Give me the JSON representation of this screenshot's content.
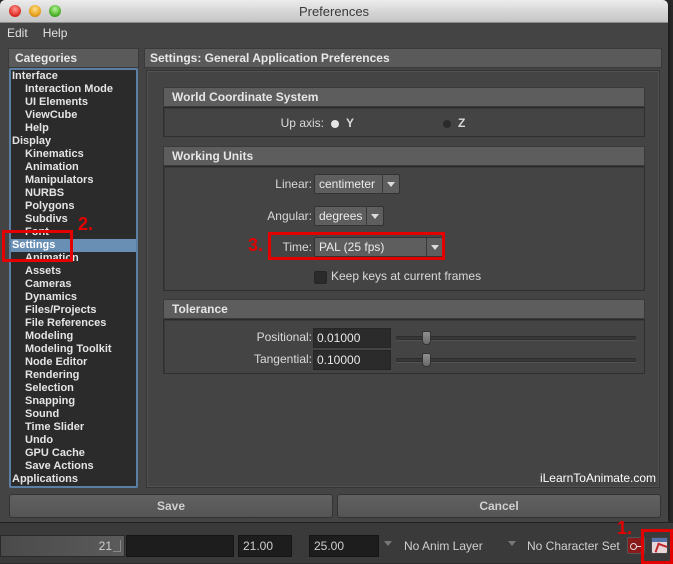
{
  "window": {
    "title": "Preferences",
    "menu": [
      "Edit",
      "Help"
    ]
  },
  "categories": {
    "header": "Categories",
    "items": [
      {
        "label": "Interface",
        "level": 0
      },
      {
        "label": "Interaction Mode",
        "level": 1
      },
      {
        "label": "UI Elements",
        "level": 1
      },
      {
        "label": "ViewCube",
        "level": 1
      },
      {
        "label": "Help",
        "level": 1
      },
      {
        "label": "Display",
        "level": 0
      },
      {
        "label": "Kinematics",
        "level": 1
      },
      {
        "label": "Animation",
        "level": 1
      },
      {
        "label": "Manipulators",
        "level": 1
      },
      {
        "label": "NURBS",
        "level": 1
      },
      {
        "label": "Polygons",
        "level": 1
      },
      {
        "label": "Subdivs",
        "level": 1
      },
      {
        "label": "Font",
        "level": 1
      },
      {
        "label": "Settings",
        "level": 0,
        "selected": true
      },
      {
        "label": "Animation",
        "level": 1
      },
      {
        "label": "Assets",
        "level": 1
      },
      {
        "label": "Cameras",
        "level": 1
      },
      {
        "label": "Dynamics",
        "level": 1
      },
      {
        "label": "Files/Projects",
        "level": 1
      },
      {
        "label": "File References",
        "level": 1
      },
      {
        "label": "Modeling",
        "level": 1
      },
      {
        "label": "Modeling Toolkit",
        "level": 1
      },
      {
        "label": "Node Editor",
        "level": 1
      },
      {
        "label": "Rendering",
        "level": 1
      },
      {
        "label": "Selection",
        "level": 1
      },
      {
        "label": "Snapping",
        "level": 1
      },
      {
        "label": "Sound",
        "level": 1
      },
      {
        "label": "Time Slider",
        "level": 1
      },
      {
        "label": "Undo",
        "level": 1
      },
      {
        "label": "GPU Cache",
        "level": 1
      },
      {
        "label": "Save Actions",
        "level": 1
      },
      {
        "label": "Applications",
        "level": 0
      }
    ]
  },
  "settings": {
    "header": "Settings: General Application Preferences",
    "world": {
      "title": "World Coordinate System",
      "up_axis_label": "Up axis:",
      "options": [
        {
          "label": "Y",
          "selected": true
        },
        {
          "label": "Z",
          "selected": false
        }
      ]
    },
    "units": {
      "title": "Working Units",
      "linear_label": "Linear:",
      "linear_value": "centimeter",
      "angular_label": "Angular:",
      "angular_value": "degrees",
      "time_label": "Time:",
      "time_value": "PAL (25 fps)",
      "keep_keys_label": "Keep keys at current frames",
      "keep_keys_checked": false
    },
    "tolerance": {
      "title": "Tolerance",
      "positional_label": "Positional:",
      "positional_value": "0.01000",
      "positional_slider_fraction": 0.11,
      "tangential_label": "Tangential:",
      "tangential_value": "0.10000",
      "tangential_slider_fraction": 0.11
    }
  },
  "watermark": "iLearnToAnimate.com",
  "buttons": {
    "save": "Save",
    "cancel": "Cancel"
  },
  "annotations": {
    "step1": "1.",
    "step2": "2.",
    "step3": "3.",
    "color": "#e50000"
  },
  "statusbar": {
    "current_frame": "21",
    "range_start": "21.00",
    "range_end": "25.00",
    "anim_layer": "No Anim Layer",
    "character_set": "No Character Set"
  }
}
